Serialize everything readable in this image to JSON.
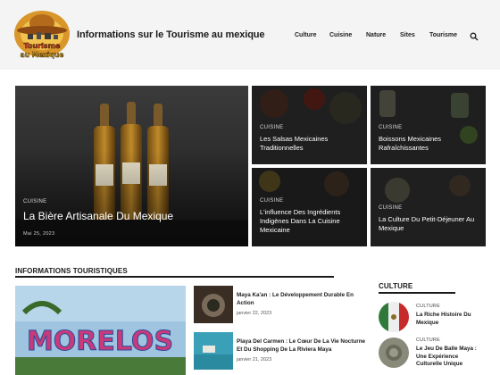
{
  "header": {
    "logo_text_top": "Tourisme",
    "logo_text_bottom": "au Mexique",
    "site_title": "Informations sur le Tourisme au mexique",
    "nav": [
      "Culture",
      "Cuisine",
      "Nature",
      "Sites",
      "Tourisme"
    ],
    "search_icon": "search-icon"
  },
  "hero": {
    "category": "CUISINE",
    "title": "La Bière Artisanale Du Mexique",
    "date": "Mai 25, 2023"
  },
  "tiles": [
    {
      "category": "CUISINE",
      "title": "Les Salsas Mexicaines Traditionnelles"
    },
    {
      "category": "CUISINE",
      "title": "Boissons Mexicaines Rafraîchissantes"
    },
    {
      "category": "CUISINE",
      "title": "L'influence Des Ingrédients Indigènes Dans La Cuisine Mexicaine"
    },
    {
      "category": "CUISINE",
      "title": "La Culture Du Petit-Déjeuner Au Mexique"
    }
  ],
  "tourist_info": {
    "heading": "INFORMATIONS TOURISTIQUES",
    "feature_sign": "MORELOS",
    "items": [
      {
        "title": "Maya Ka'an : Le Développement Durable En Action",
        "date": "janvier 22, 2023"
      },
      {
        "title": "Playa Del Carmen : Le Cœur De La Vie Nocturne Et Du Shopping De La Riviera Maya",
        "date": "janvier 21, 2023"
      }
    ]
  },
  "culture": {
    "heading": "CULTURE",
    "items": [
      {
        "category": "CULTURE",
        "title": "La Riche Histoire Du Mexique"
      },
      {
        "category": "CULTURE",
        "title": "Le Jeu De Balle Maya : Une Expérience Culturelle Unique"
      }
    ]
  },
  "colors": {
    "header_bg": "#f4f4f4",
    "tile_overlay": "#2a2a2a",
    "text": "#1b1b1b"
  }
}
